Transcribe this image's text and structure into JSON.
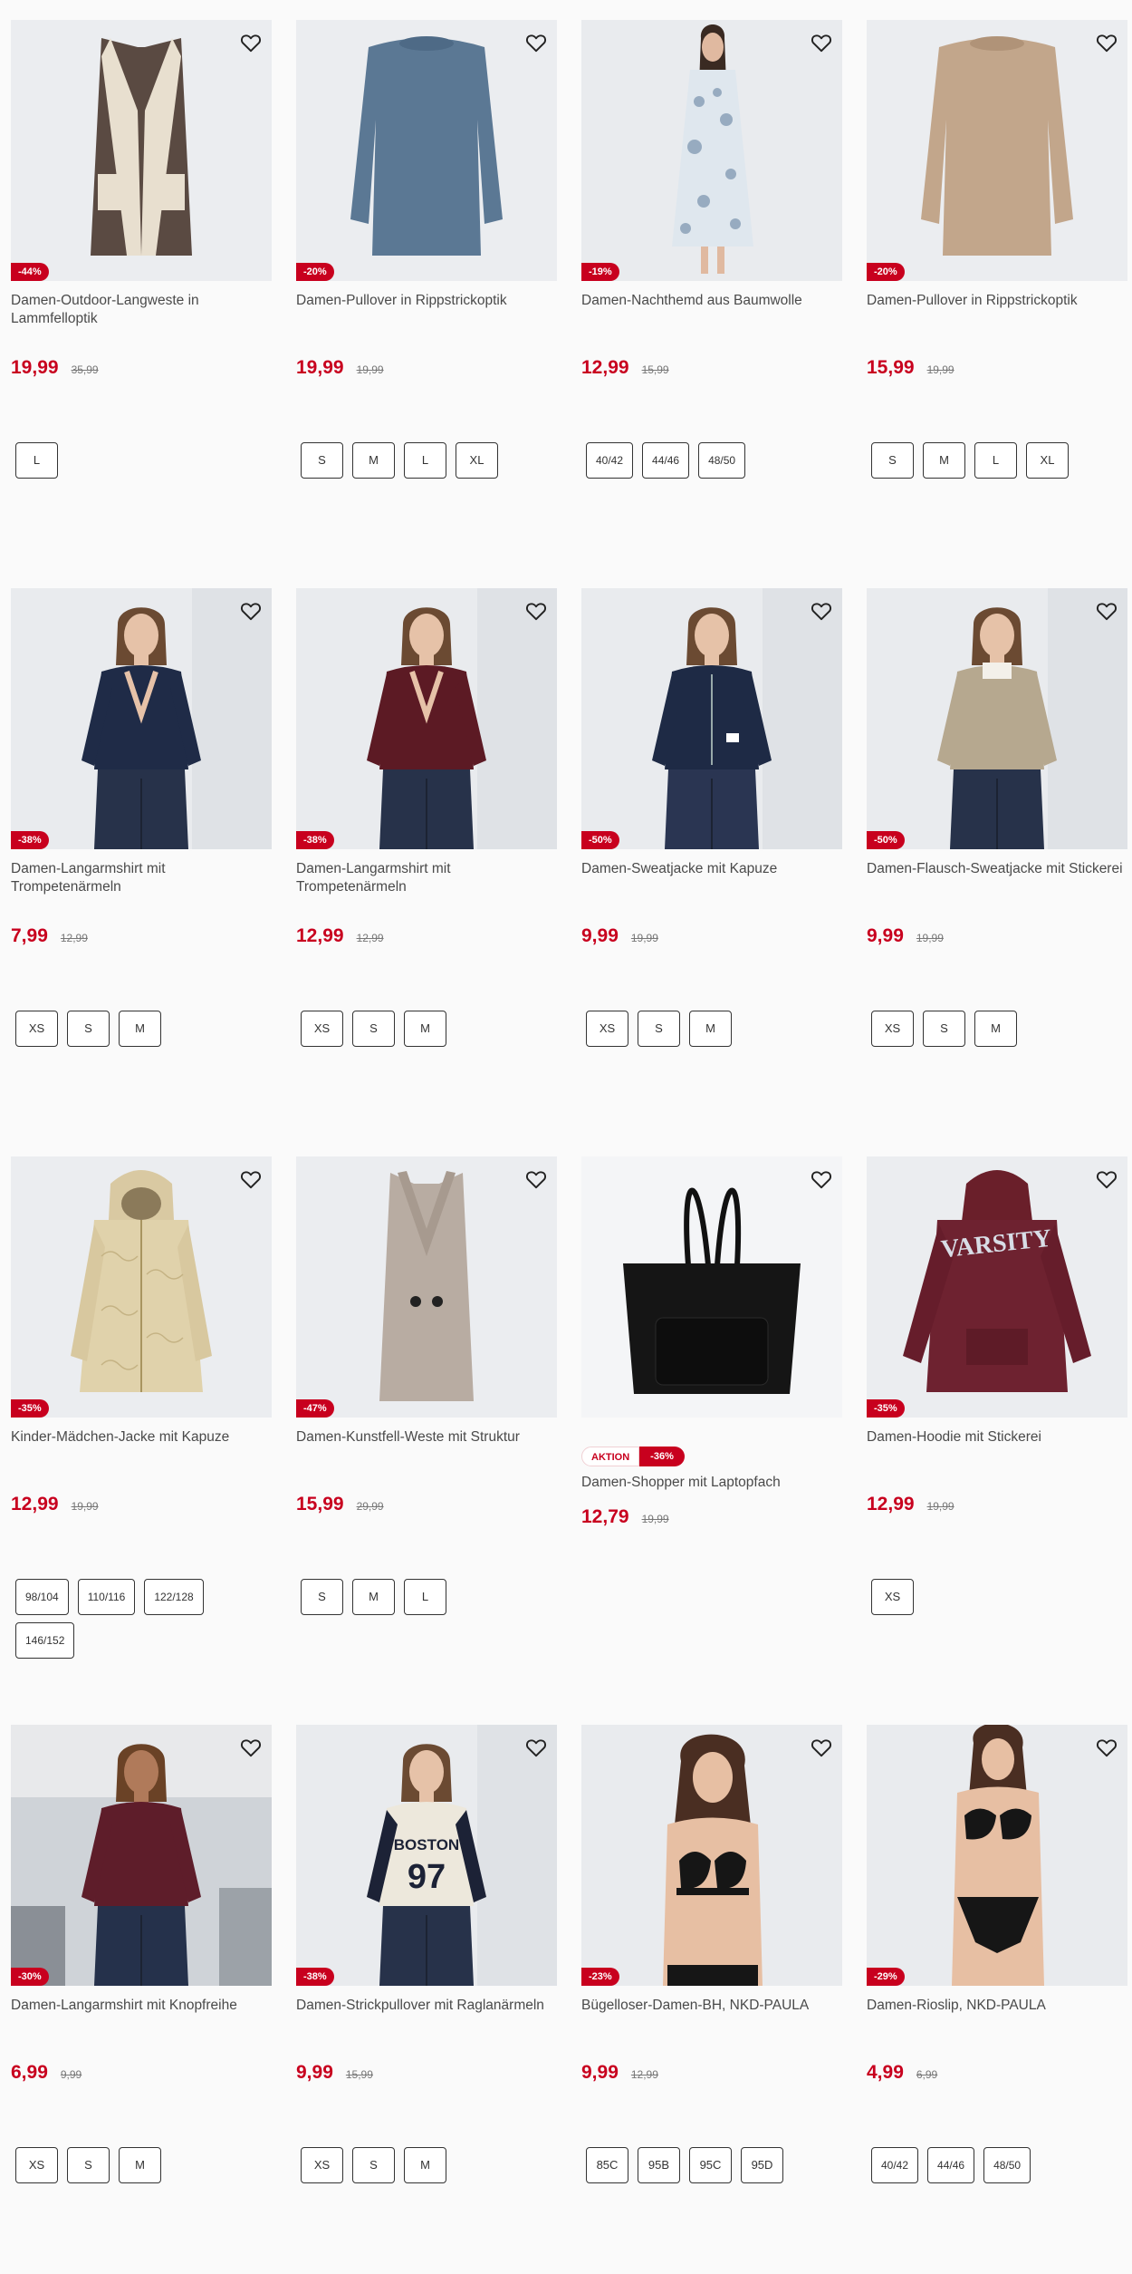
{
  "products": [
    {
      "name": "Damen-Outdoor-Langweste in Lammfelloptik",
      "price": "19,99",
      "old": "35,99",
      "discount": "-44%",
      "sizes": [
        "L"
      ],
      "art": "vest-brown"
    },
    {
      "name": "Damen-Pullover in Rippstrickoptik",
      "price": "19,99",
      "old": "19,99",
      "discount": "-20%",
      "sizes": [
        "S",
        "M",
        "L",
        "XL"
      ],
      "art": "sweater-blue"
    },
    {
      "name": "Damen-Nachthemd aus Baumwolle",
      "price": "12,99",
      "old": "15,99",
      "discount": "-19%",
      "sizes": [
        "40/42",
        "44/46",
        "48/50"
      ],
      "art": "nightgown"
    },
    {
      "name": "Damen-Pullover in Rippstrickoptik",
      "price": "15,99",
      "old": "19,99",
      "discount": "-20%",
      "sizes": [
        "S",
        "M",
        "L",
        "XL"
      ],
      "art": "sweater-beige"
    },
    {
      "name": "Damen-Langarmshirt mit Trompetenärmeln",
      "price": "7,99",
      "old": "12,99",
      "discount": "-38%",
      "sizes": [
        "XS",
        "S",
        "M"
      ],
      "art": "model-navy"
    },
    {
      "name": "Damen-Langarmshirt mit Trompetenärmeln",
      "price": "12,99",
      "old": "12,99",
      "discount": "-38%",
      "sizes": [
        "XS",
        "S",
        "M"
      ],
      "art": "model-burgundy"
    },
    {
      "name": "Damen-Sweatjacke mit Kapuze",
      "price": "9,99",
      "old": "19,99",
      "discount": "-50%",
      "sizes": [
        "XS",
        "S",
        "M"
      ],
      "art": "model-hoodie-navy"
    },
    {
      "name": "Damen-Flausch-Sweatjacke mit Stickerei",
      "price": "9,99",
      "old": "19,99",
      "discount": "-50%",
      "sizes": [
        "XS",
        "S",
        "M"
      ],
      "art": "model-beige"
    },
    {
      "name": "Kinder-Mädchen-Jacke mit Kapuze",
      "price": "12,99",
      "old": "19,99",
      "discount": "-35%",
      "sizes": [
        "98/104",
        "110/116",
        "122/128",
        "146/152"
      ],
      "art": "jacket-gold"
    },
    {
      "name": "Damen-Kunstfell-Weste mit Struktur",
      "price": "15,99",
      "old": "29,99",
      "discount": "-47%",
      "sizes": [
        "S",
        "M",
        "L"
      ],
      "art": "vest-taupe"
    },
    {
      "name": "Damen-Shopper mit Laptopfach",
      "price": "12,79",
      "old": "19,99",
      "discount": "",
      "aktion": "AKTION",
      "aktion_discount": "-36%",
      "sizes": [],
      "art": "bag"
    },
    {
      "name": "Damen-Hoodie mit Stickerei",
      "price": "12,99",
      "old": "19,99",
      "discount": "-35%",
      "sizes": [
        "XS"
      ],
      "art": "hoodie-varsity"
    },
    {
      "name": "Damen-Langarmshirt mit Knopfreihe",
      "price": "6,99",
      "old": "9,99",
      "discount": "-30%",
      "sizes": [
        "XS",
        "S",
        "M"
      ],
      "art": "model-mall"
    },
    {
      "name": "Damen-Strickpullover mit Raglanärmeln",
      "price": "9,99",
      "old": "15,99",
      "discount": "-38%",
      "sizes": [
        "XS",
        "S",
        "M"
      ],
      "art": "model-boston"
    },
    {
      "name": "Bügelloser-Damen-BH, NKD-PAULA",
      "price": "9,99",
      "old": "12,99",
      "discount": "-23%",
      "sizes": [
        "85C",
        "95B",
        "95C",
        "95D"
      ],
      "art": "model-bra"
    },
    {
      "name": "Damen-Rioslip, NKD-PAULA",
      "price": "4,99",
      "old": "6,99",
      "discount": "-29%",
      "sizes": [
        "40/42",
        "44/46",
        "48/50"
      ],
      "art": "model-brief"
    }
  ],
  "print_texts": {
    "boston": "BOSTON",
    "boston_num": "97",
    "varsity": "VARSITY"
  },
  "colors": {
    "accent": "#c8001e",
    "text": "#4a4a4a",
    "bg": "#fafafa"
  }
}
